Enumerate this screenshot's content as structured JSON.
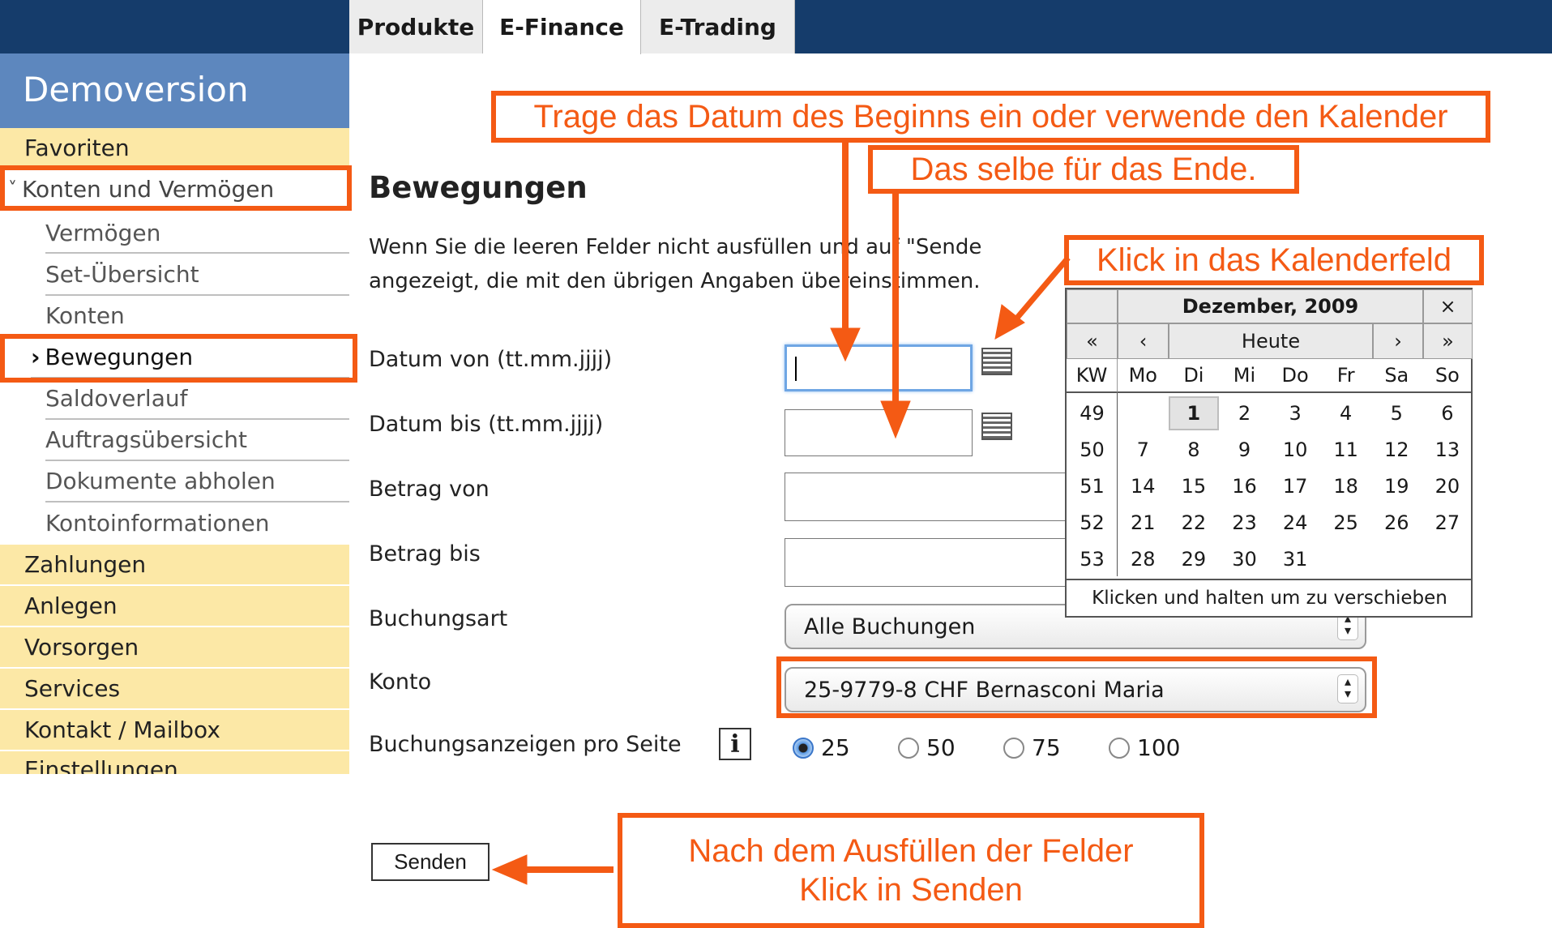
{
  "tabs": [
    "Produkte",
    "E-Finance",
    "E-Trading"
  ],
  "sidebar": {
    "header": "Demoversion",
    "favoriten": "Favoriten",
    "group_arrow": "˅",
    "group_label": "Konten und Vermögen",
    "sub_items": [
      "Vermögen",
      "Set-Übersicht",
      "Konten",
      "Bewegungen",
      "Saldoverlauf",
      "Auftragsübersicht",
      "Dokumente abholen",
      "Kontoinformationen"
    ],
    "active_marker": "›",
    "main_items": [
      "Zahlungen",
      "Anlegen",
      "Vorsorgen",
      "Services",
      "Kontakt / Mailbox",
      "Einstellungen"
    ]
  },
  "main": {
    "title": "Bewegungen",
    "desc_line1": "Wenn Sie die leeren Felder nicht ausfüllen und auf \"Sende",
    "desc_line2": "angezeigt, die mit den übrigen Angaben übereinstimmen.",
    "labels": {
      "datum_von": "Datum von (tt.mm.jjjj)",
      "datum_bis": "Datum bis (tt.mm.jjjj)",
      "betrag_von": "Betrag von",
      "betrag_bis": "Betrag bis",
      "buchungsart": "Buchungsart",
      "konto": "Konto",
      "pro_seite": "Buchungsanzeigen pro Seite"
    },
    "buchungsart_value": "Alle Buchungen",
    "konto_value": "25-9779-8 CHF Bernasconi Maria",
    "info_glyph": "i",
    "per_page_options": [
      "25",
      "50",
      "75",
      "100"
    ],
    "per_page_selected": "25",
    "send_label": "Senden"
  },
  "calendar": {
    "title": "Dezember, 2009",
    "close": "×",
    "nav": {
      "prev_year": "«",
      "prev_month": "‹",
      "today": "Heute",
      "next_month": "›",
      "next_year": "»"
    },
    "week_col": "KW",
    "weekdays": [
      "Mo",
      "Di",
      "Mi",
      "Do",
      "Fr",
      "Sa",
      "So"
    ],
    "weeks": [
      {
        "kw": "49",
        "days": [
          "",
          "1",
          "2",
          "3",
          "4",
          "5",
          "6"
        ]
      },
      {
        "kw": "50",
        "days": [
          "7",
          "8",
          "9",
          "10",
          "11",
          "12",
          "13"
        ]
      },
      {
        "kw": "51",
        "days": [
          "14",
          "15",
          "16",
          "17",
          "18",
          "19",
          "20"
        ]
      },
      {
        "kw": "52",
        "days": [
          "21",
          "22",
          "23",
          "24",
          "25",
          "26",
          "27"
        ]
      },
      {
        "kw": "53",
        "days": [
          "28",
          "29",
          "30",
          "31",
          "",
          "",
          ""
        ]
      }
    ],
    "selected_day": "1",
    "footer": "Klicken und halten um zu verschieben"
  },
  "annotations": {
    "begin": "Trage das Datum des Beginns ein oder verwende den Kalender",
    "end": "Das selbe für das Ende.",
    "calendar": "Klick in das Kalenderfeld",
    "send_line1": "Nach dem Ausfüllen der Felder",
    "send_line2": "Klick in Senden"
  },
  "colors": {
    "accent": "#f45a14",
    "topbar": "#153c6b",
    "sidebar_header": "#5d87be",
    "sidebar_yellow": "#fce8a6"
  }
}
